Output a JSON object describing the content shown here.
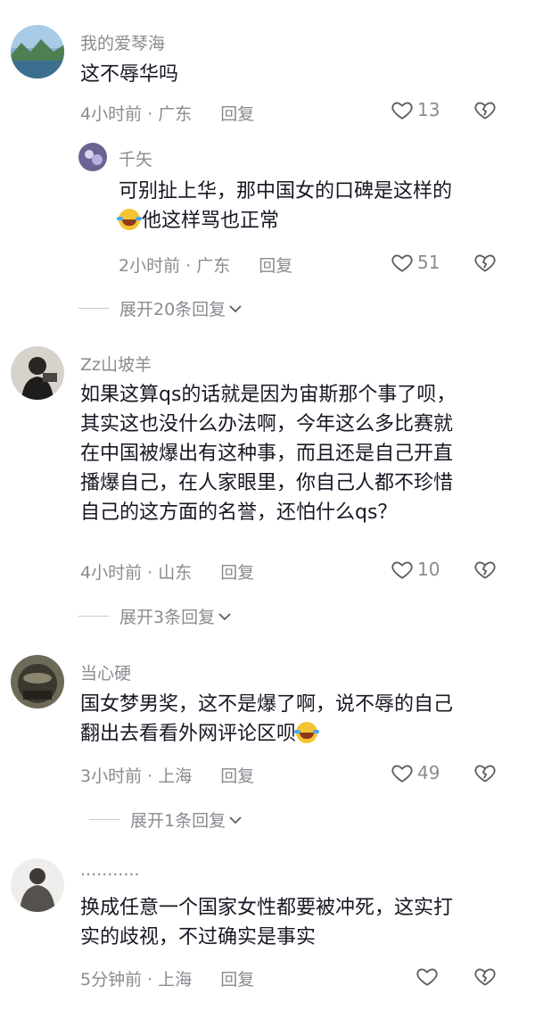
{
  "comments": [
    {
      "username": "我的爱琴海",
      "lines": [
        "这不辱华吗"
      ],
      "time": "4小时前",
      "location": "广东",
      "reply_label": "回复",
      "likes": "13"
    },
    {
      "username": "千矢",
      "lines": [
        "可别扯上华，那中国女的口碑是这样的",
        "他这样骂也正常"
      ],
      "emoji_icon": "rolling-laughing-emoji",
      "time": "2小时前",
      "location": "广东",
      "reply_label": "回复",
      "likes": "51"
    },
    {
      "username": "Zz山坡羊",
      "lines": [
        "如果这算qs的话就是因为宙斯那个事了呗，",
        "其实这也没什么办法啊，今年这么多比赛就",
        "在中国被爆出有这种事，而且还是自己开直",
        "播爆自己，在人家眼里，你自己人都不珍惜",
        "自己的这方面的名誉，还怕什么qs？"
      ],
      "time": "4小时前",
      "location": "山东",
      "reply_label": "回复",
      "likes": "10"
    },
    {
      "username": "当心硬",
      "lines": [
        "国女梦男奖，这不是爆了啊，说不辱的自己",
        "翻出去看看外网评论区呗"
      ],
      "emoji_icon": "rolling-laughing-emoji",
      "time": "3小时前",
      "location": "上海",
      "reply_label": "回复",
      "likes": "49"
    },
    {
      "username": "...........",
      "lines": [
        "换成任意一个国家女性都要被冲死，这实打",
        "实的歧视，不过确实是事实"
      ],
      "time": "5分钟前",
      "location": "上海",
      "reply_label": "回复",
      "likes": ""
    }
  ],
  "expanders": [
    {
      "label": "展开20条回复"
    },
    {
      "label": "展开3条回复"
    },
    {
      "label": "展开1条回复"
    }
  ],
  "colors": {
    "text": "#161823",
    "secondary": "#8a8b91",
    "background": "#ffffff"
  }
}
